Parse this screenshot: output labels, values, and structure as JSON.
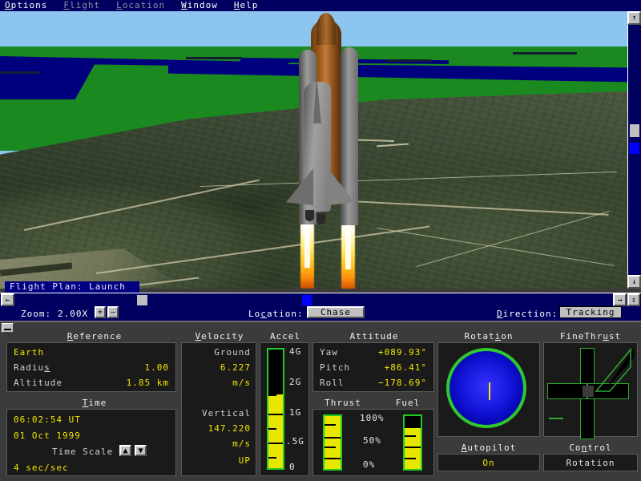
{
  "menu": {
    "items": [
      {
        "label": "Options",
        "enabled": true
      },
      {
        "label": "Flight",
        "enabled": false
      },
      {
        "label": "Location",
        "enabled": false
      },
      {
        "label": "Window",
        "enabled": true
      },
      {
        "label": "Help",
        "enabled": true
      }
    ]
  },
  "viewport": {
    "flight_plan_label": "Flight Plan: Launch",
    "scene": "space shuttle launch over coastal terrain"
  },
  "control_strip": {
    "zoom_label": "Zoom:",
    "zoom_value": "2.00X",
    "zoom_in_glyph": "+",
    "zoom_out_glyph": "–",
    "location_label": "Location:",
    "location_value": "Chase",
    "direction_label": "Direction:",
    "direction_value": "Tracking"
  },
  "scrollbars": {
    "up_glyph": "↑",
    "down_glyph": "↓",
    "left_glyph": "←",
    "right_glyph": "→",
    "corner_glyph": "⇕"
  },
  "panel": {
    "reference": {
      "title": "Reference",
      "title_accel": "R",
      "body_name": "Earth",
      "rows": [
        {
          "label": "Radius",
          "value": "1.00"
        },
        {
          "label": "Altitude",
          "value": "1.85 km"
        }
      ]
    },
    "time": {
      "title": "Time",
      "title_accel": "T",
      "clock": "06:02:54 UT",
      "date": "01 Oct 1999",
      "scale_label": "Time Scale",
      "scale_value": "4 sec/sec",
      "up_glyph": "▲",
      "down_glyph": "▼"
    },
    "velocity": {
      "title": "Velocity",
      "title_accel": "V",
      "ground_label": "Ground",
      "ground_value": "6.227",
      "ground_units": "m/s",
      "vertical_label": "Vertical",
      "vertical_value": "147.220",
      "vertical_units": "m/s",
      "vertical_dir": "UP"
    },
    "accel": {
      "title": "Accel",
      "ticks": [
        "4G",
        "2G",
        "1G",
        ".5G",
        "0"
      ],
      "fill_percent": 62
    },
    "attitude": {
      "title": "Attitude",
      "rows": [
        {
          "label": "Yaw",
          "value": "+089.93°"
        },
        {
          "label": "Pitch",
          "value": "+86.41°"
        },
        {
          "label": "Roll",
          "value": "−178.69°"
        }
      ]
    },
    "thrust": {
      "title": "Thrust",
      "fill_percent": 100
    },
    "fuel": {
      "title": "Fuel",
      "fill_percent": 78
    },
    "thrust_scale": {
      "ticks": [
        "100%",
        "50%",
        "0%"
      ]
    },
    "rotation": {
      "title": "Rotation",
      "title_accel": "i"
    },
    "autopilot": {
      "title": "Autopilot",
      "title_accel": "A",
      "value": "On"
    },
    "finethrust": {
      "title": "FineThrust",
      "title_accel": "u"
    },
    "control": {
      "title": "Control",
      "title_accel": "n",
      "value": "Rotation"
    }
  },
  "colors": {
    "menu_bg": "#000060",
    "panel_bg": "#3b3b3b",
    "readout_yellow": "#f2e600",
    "gauge_green": "#22cc22",
    "gauge_fill": "#e6e600",
    "rotation_blue": "#1414d8",
    "sky": "#8cc6ee",
    "terrain_green": "#1a8a20",
    "water": "#00007f"
  }
}
